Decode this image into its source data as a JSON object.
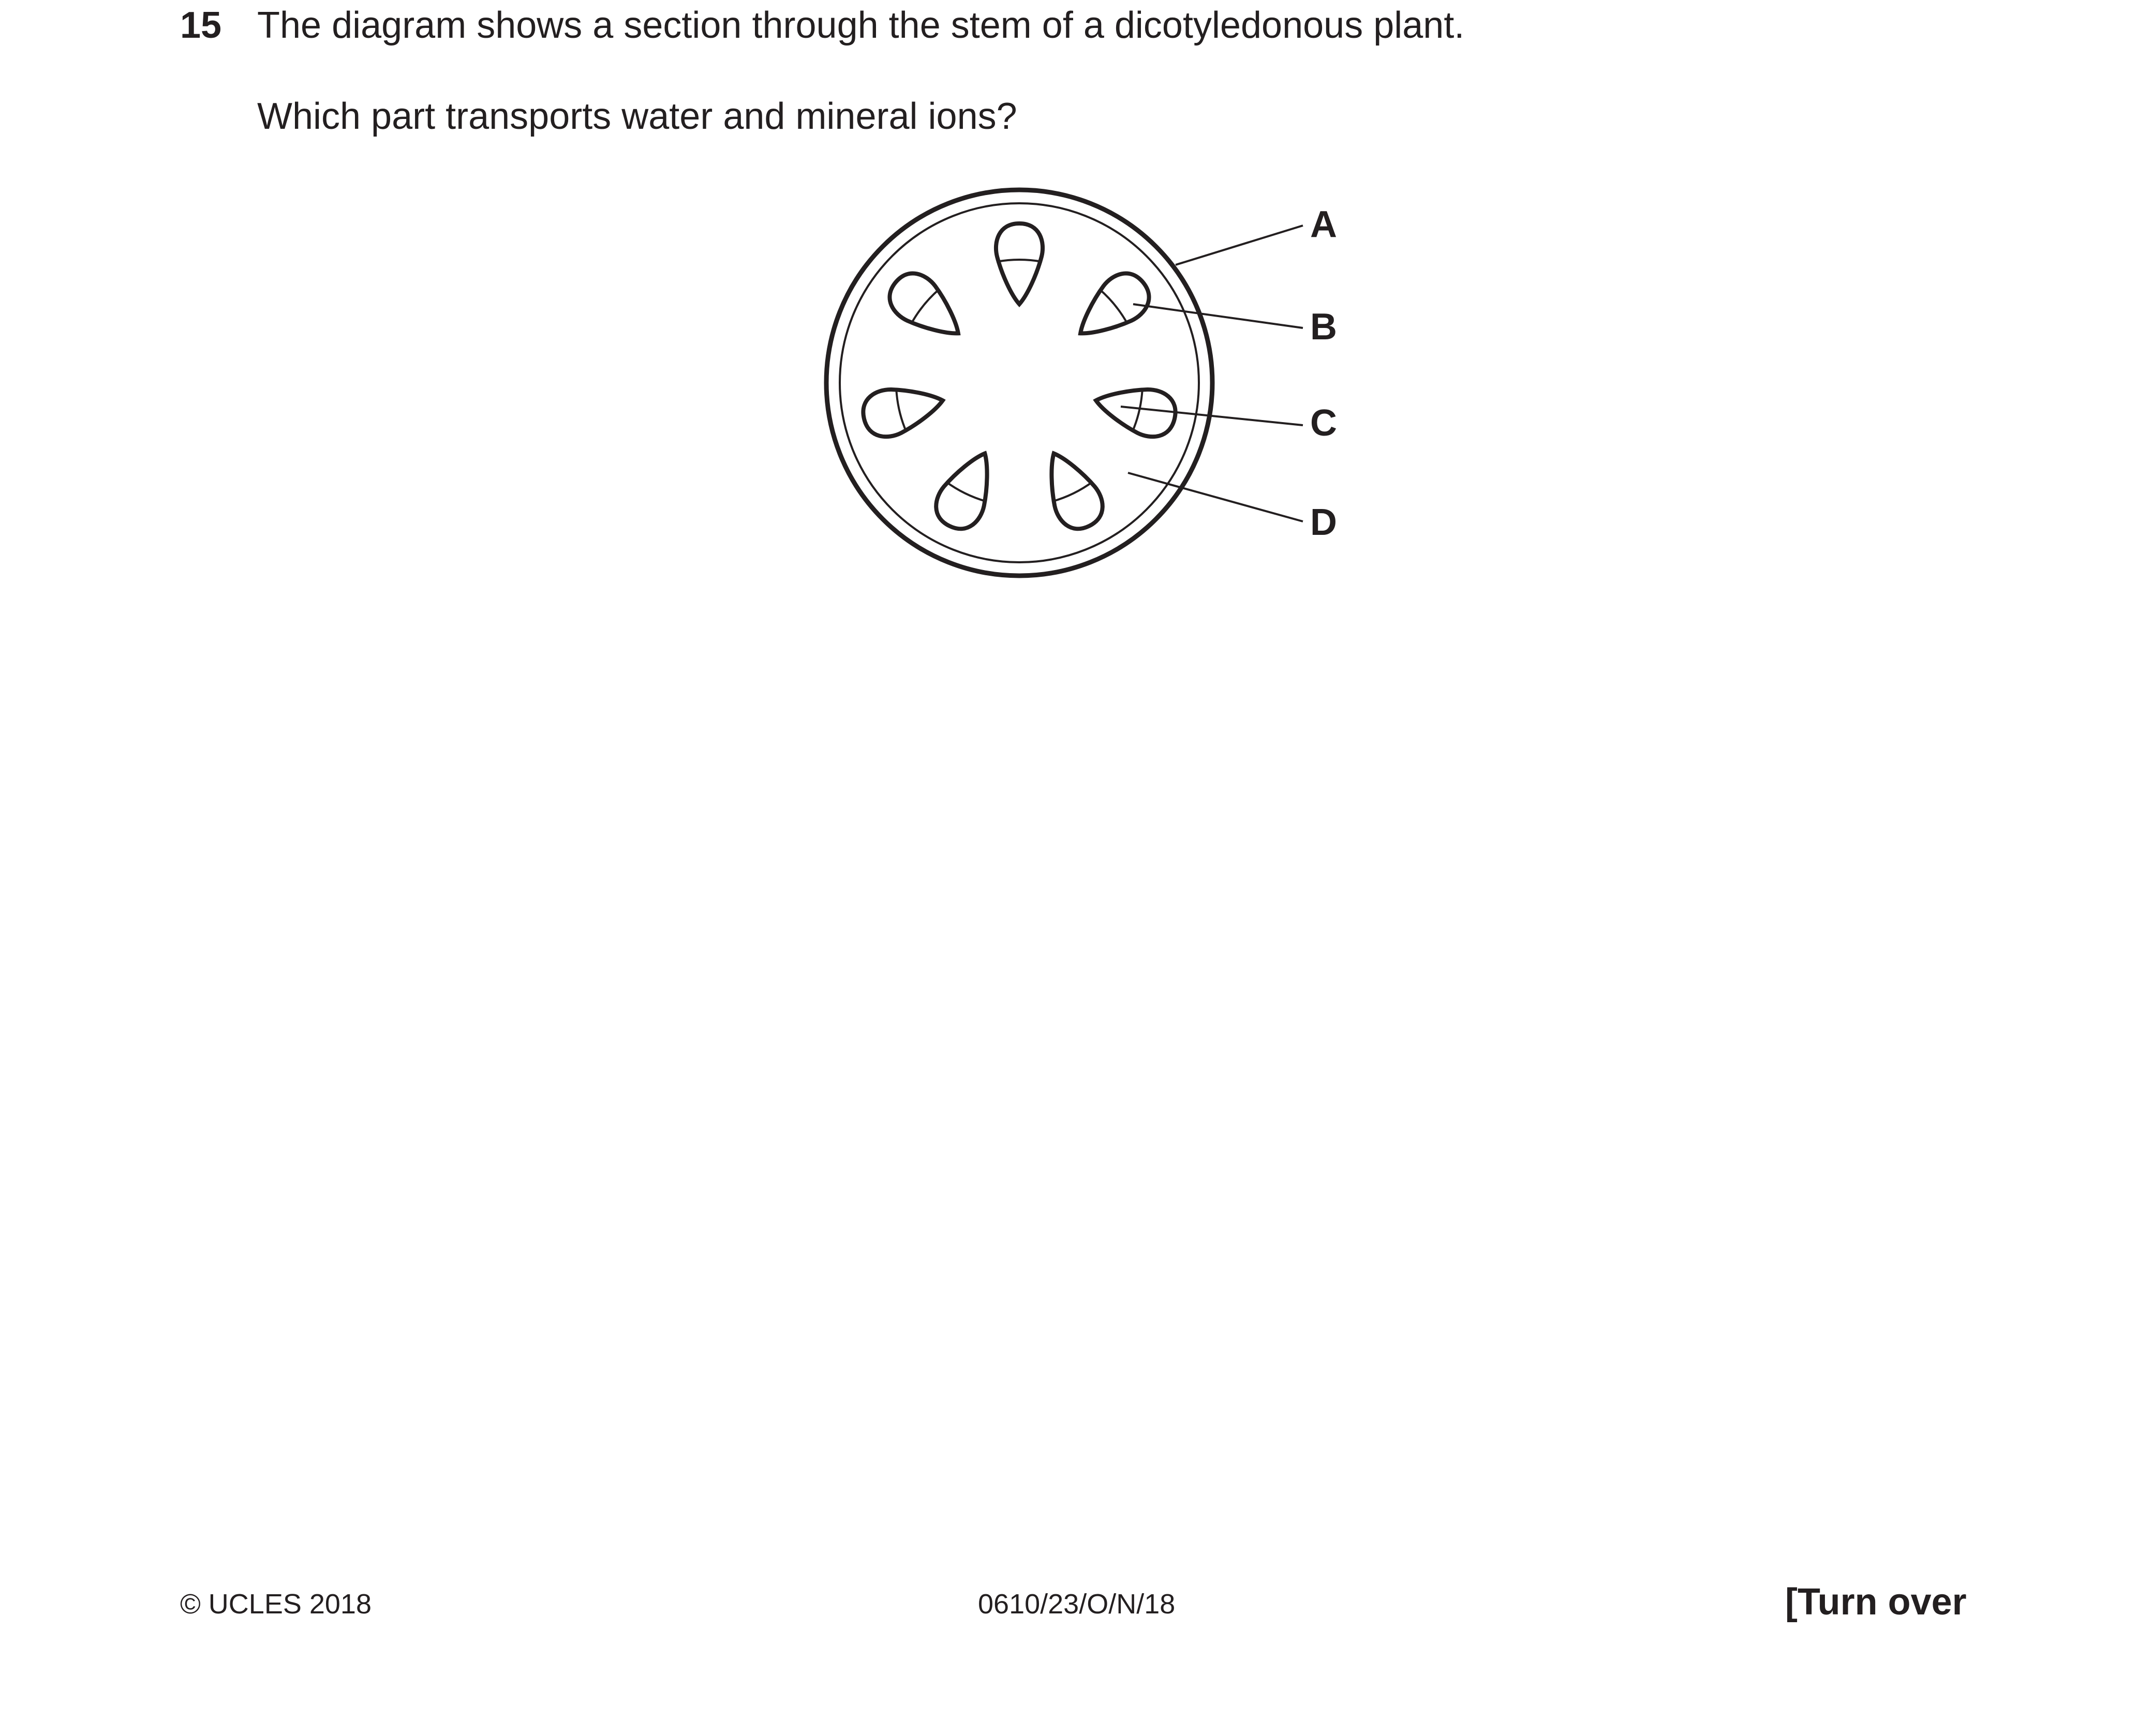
{
  "question": {
    "number": "15",
    "statement": "The diagram shows a section through the stem of a dicotyledonous plant.",
    "prompt": "Which part transports water and mineral ions?"
  },
  "diagram": {
    "labels": {
      "a": "A",
      "b": "B",
      "c": "C",
      "d": "D"
    }
  },
  "footer": {
    "copyright": "© UCLES 2018",
    "paper_code": "0610/23/O/N/18",
    "turn_over": "[Turn over"
  }
}
